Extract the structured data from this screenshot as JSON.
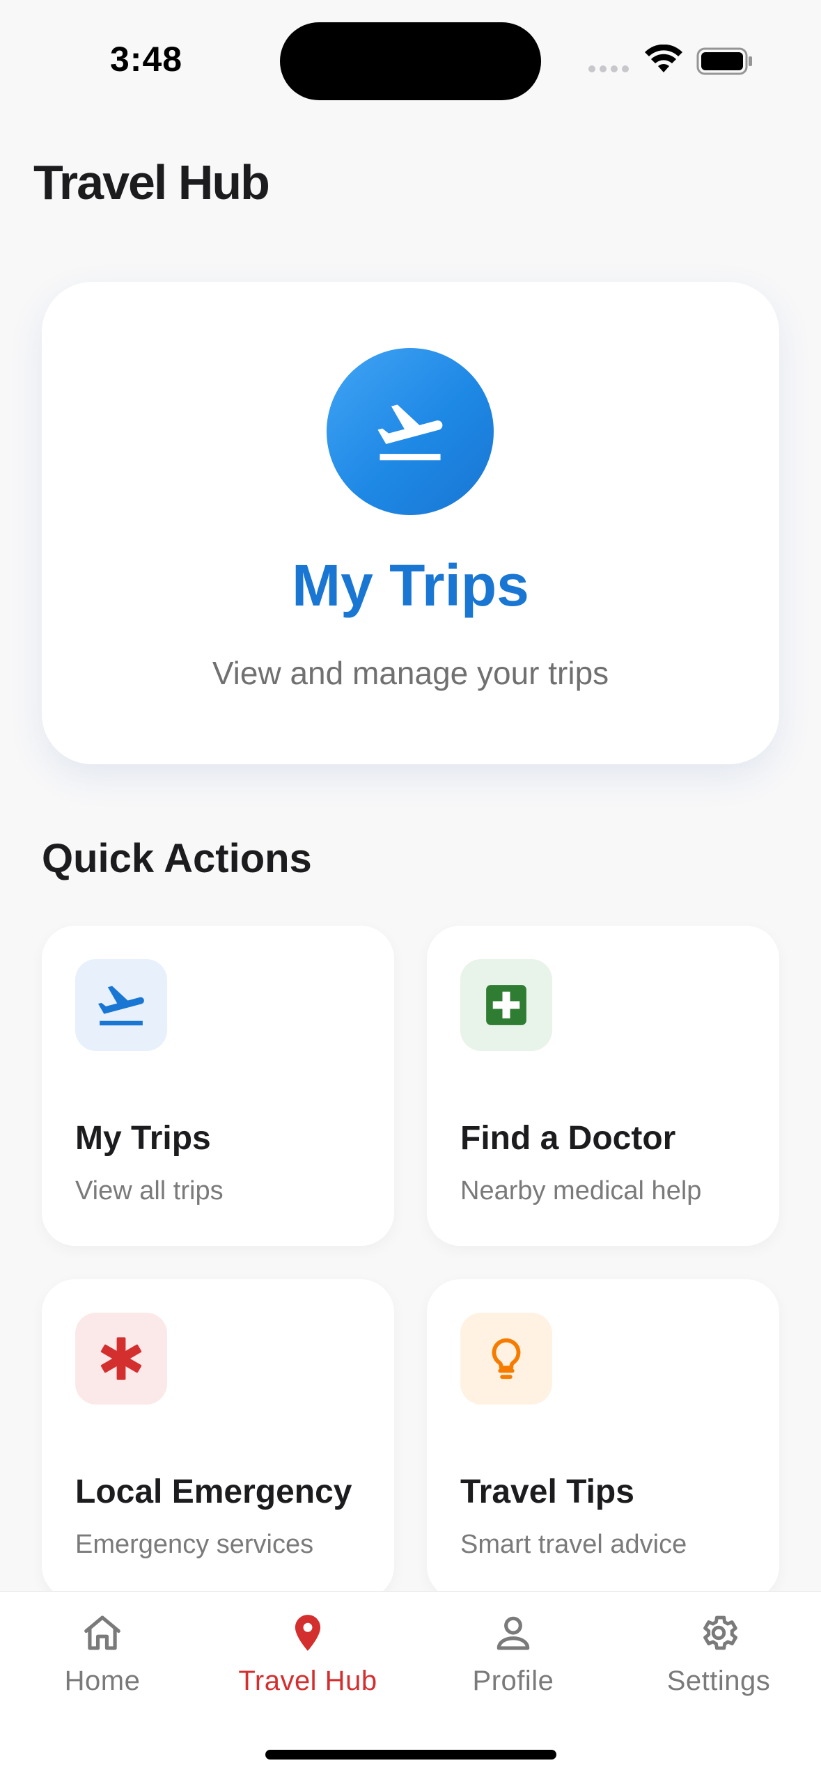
{
  "status_bar": {
    "time": "3:48"
  },
  "header": {
    "title": "Travel Hub"
  },
  "hero": {
    "icon": "airplane-departure-icon",
    "title": "My Trips",
    "subtitle": "View and manage your trips",
    "accent_color": "#1976d2"
  },
  "quick_actions": {
    "title": "Quick Actions",
    "items": [
      {
        "title": "My Trips",
        "subtitle": "View all trips",
        "icon": "airplane-departure-icon",
        "icon_color": "#1976d2",
        "icon_bg": "#e7f0fb"
      },
      {
        "title": "Find a Doctor",
        "subtitle": "Nearby medical help",
        "icon": "medical-cross-icon",
        "icon_color": "#2e7d32",
        "icon_bg": "#e8f3e9"
      },
      {
        "title": "Local Emergency",
        "subtitle": "Emergency services",
        "icon": "emergency-asterisk-icon",
        "icon_color": "#d32f2f",
        "icon_bg": "#fbe9e9"
      },
      {
        "title": "Travel Tips",
        "subtitle": "Smart travel advice",
        "icon": "lightbulb-icon",
        "icon_color": "#f57c00",
        "icon_bg": "#fff2e3"
      }
    ]
  },
  "tab_bar": {
    "active_color": "#d32f2f",
    "inactive_color": "#7a7a7a",
    "tabs": [
      {
        "label": "Home",
        "icon": "home-icon",
        "active": false
      },
      {
        "label": "Travel Hub",
        "icon": "location-pin-icon",
        "active": true
      },
      {
        "label": "Profile",
        "icon": "person-icon",
        "active": false
      },
      {
        "label": "Settings",
        "icon": "gear-icon",
        "active": false
      }
    ]
  }
}
